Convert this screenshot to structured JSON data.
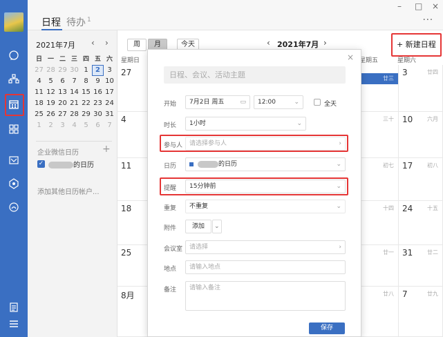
{
  "window": {
    "minimize": "–",
    "maximize": "□",
    "close": "×"
  },
  "tabs": [
    {
      "label": "日程"
    },
    {
      "label": "待办",
      "badge": "1"
    }
  ],
  "more_icon": "···",
  "mini_calendar": {
    "title": "2021年7月",
    "prev": "‹",
    "next": "›",
    "weekdays": [
      "日",
      "一",
      "二",
      "三",
      "四",
      "五",
      "六"
    ],
    "weeks": [
      [
        "27",
        "28",
        "29",
        "30",
        "1",
        "2",
        "3"
      ],
      [
        "4",
        "5",
        "6",
        "7",
        "8",
        "9",
        "10"
      ],
      [
        "11",
        "12",
        "13",
        "14",
        "15",
        "16",
        "17"
      ],
      [
        "18",
        "19",
        "20",
        "21",
        "22",
        "23",
        "24"
      ],
      [
        "25",
        "26",
        "27",
        "28",
        "29",
        "30",
        "31"
      ],
      [
        "1",
        "2",
        "3",
        "4",
        "5",
        "6",
        "7"
      ]
    ],
    "today": "2"
  },
  "calendars": {
    "section_title": "企业微信日历",
    "add": "+",
    "my_calendar_suffix": "的日历",
    "check": "✓",
    "add_other": "添加其他日历帐户..."
  },
  "toolbar": {
    "week": "周",
    "month": "月",
    "today": "今天",
    "title": "2021年7月",
    "prev": "‹",
    "next": "›",
    "new_event": "+ 新建日程"
  },
  "grid": {
    "header_sun": "星期日",
    "header_fri": "星期五",
    "header_sat": "星期六",
    "rows": [
      {
        "sun": "27",
        "fri_lunar": "廿三",
        "sat": "3",
        "sat_lunar": "廿四"
      },
      {
        "sun": "4",
        "fri_lunar": "三十",
        "sat": "10",
        "sat_lunar": "六月"
      },
      {
        "sun": "11",
        "fri_lunar": "初七",
        "sat": "17",
        "sat_lunar": "初八"
      },
      {
        "sun": "18",
        "fri_lunar": "十四",
        "sat": "24",
        "sat_lunar": "十五"
      },
      {
        "sun": "25",
        "fri_lunar": "廿一",
        "sat": "31",
        "sat_lunar": "廿二"
      },
      {
        "sun": "8月",
        "fri_lunar": "廿八",
        "sat": "7",
        "sat_lunar": "廿九"
      }
    ]
  },
  "dialog": {
    "close": "×",
    "topic_placeholder": "日程、会议、活动主题",
    "start_label": "开始",
    "start_date": "7月2日 周五",
    "start_time": "12:00",
    "all_day": "全天",
    "duration_label": "时长",
    "duration": "1小时",
    "attendees_label": "参与人",
    "attendees_placeholder": "请选择参与人",
    "calendar_label": "日历",
    "calendar_suffix": "的日历",
    "reminder_label": "提醒",
    "reminder": "15分钟前",
    "repeat_label": "重复",
    "repeat": "不重复",
    "attach_label": "附件",
    "attach": "添加",
    "room_label": "会议室",
    "room_placeholder": "请选择",
    "location_label": "地点",
    "location_placeholder": "请输入地点",
    "notes_label": "备注",
    "notes_placeholder": "请输入备注",
    "save": "保存"
  },
  "colors": {
    "accent": "#3a6fc2",
    "highlight": "#e53535",
    "rail": "#3a6fc2"
  }
}
